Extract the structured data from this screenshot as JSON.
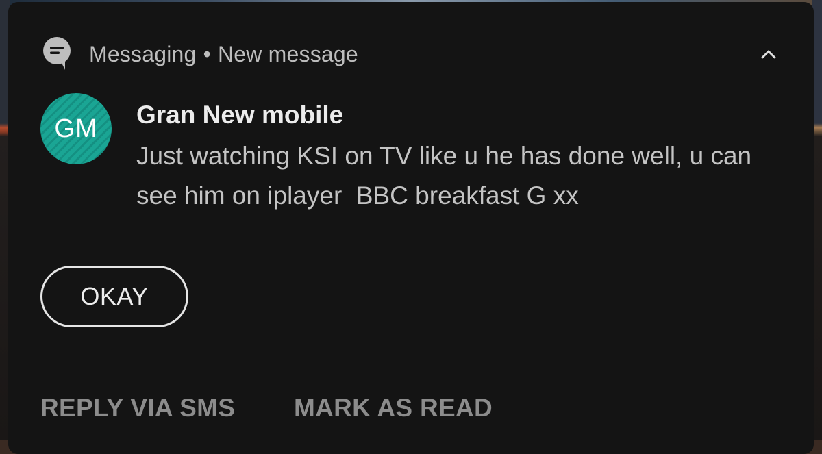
{
  "notification": {
    "app_name": "Messaging",
    "separator": "•",
    "subtitle": "New message",
    "app_icon": "message-bubble-icon",
    "collapse_icon": "chevron-up-icon",
    "avatar": {
      "initials": "GM",
      "color": "#1aa594"
    },
    "sender": "Gran New mobile",
    "message": "Just watching KSI on TV like u he has done well, u can see him on iplayer  BBC breakfast G xx",
    "smart_reply": "OKAY",
    "actions": {
      "reply": "REPLY VIA SMS",
      "mark_read": "MARK AS READ"
    }
  }
}
